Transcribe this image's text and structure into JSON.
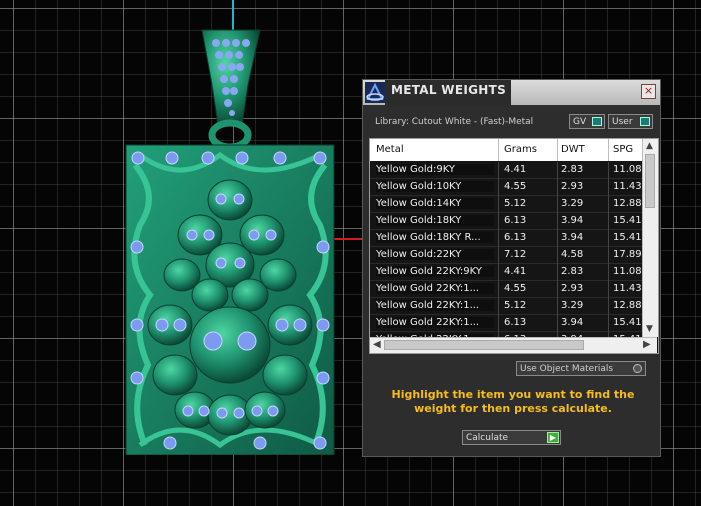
{
  "dialog": {
    "title": "METAL WEIGHTS",
    "close_label": "×",
    "library_label": "Library: Cutout White - (Fast)-Metal",
    "gv_label": "GV",
    "user_label": "User",
    "use_object_materials_label": "Use Object Materials",
    "instruction": "Highlight the item you want to find the weight for then press calculate.",
    "calculate_label": "Calculate",
    "calculate_icon": "play-icon"
  },
  "table": {
    "columns": [
      "Metal",
      "Grams",
      "DWT",
      "SPG"
    ],
    "rows": [
      [
        "Yellow Gold:9KY",
        "4.41",
        "2.83",
        "11.08"
      ],
      [
        "Yellow Gold:10KY",
        "4.55",
        "2.93",
        "11.43"
      ],
      [
        "Yellow Gold:14KY",
        "5.12",
        "3.29",
        "12.88"
      ],
      [
        "Yellow Gold:18KY",
        "6.13",
        "3.94",
        "15.41"
      ],
      [
        "Yellow Gold:18KY R...",
        "6.13",
        "3.94",
        "15.41"
      ],
      [
        "Yellow Gold:22KY",
        "7.12",
        "4.58",
        "17.89"
      ],
      [
        "Yellow Gold 22KY:9KY",
        "4.41",
        "2.83",
        "11.08"
      ],
      [
        "Yellow Gold 22KY:1...",
        "4.55",
        "2.93",
        "11.43"
      ],
      [
        "Yellow Gold 22KY:1...",
        "5.12",
        "3.29",
        "12.88"
      ],
      [
        "Yellow Gold 22KY:1...",
        "6.13",
        "3.94",
        "15.41"
      ],
      [
        "Yellow Gold 22KY:1...",
        "6.13",
        "3.94",
        "15.41"
      ]
    ]
  },
  "colors": {
    "pendant_green": "#1e8e6a",
    "gem_blue": "#7b9af0",
    "instruction_yellow": "#f6bd1d",
    "axis_y": "#1fb8c6",
    "axis_x": "#d41c1c"
  },
  "viewport": {
    "object": "skull-pendant-model"
  }
}
